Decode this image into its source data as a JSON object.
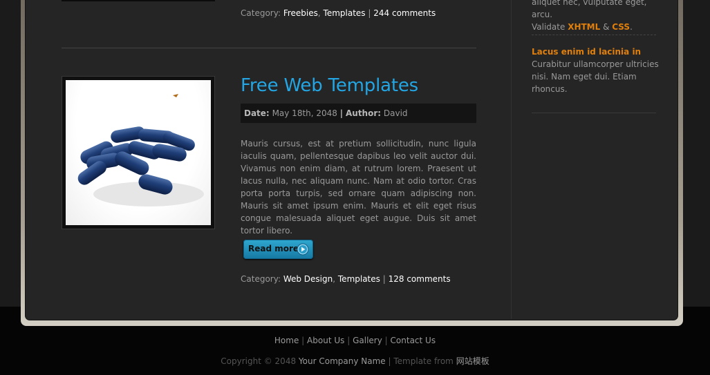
{
  "prev_post": {
    "category_label": "Category:",
    "categories": [
      "Freebies",
      "Templates"
    ],
    "comments": "244 comments"
  },
  "post": {
    "title": "Free Web Templates",
    "date_label": "Date:",
    "date": "May 18th, 2048",
    "author_label": "Author:",
    "author": "David",
    "body": "Mauris cursus, est at pretium sollicitudin, nunc ligula iaculis quam, pellentesque dapibus leo velit auctor dui. Vivamus non enim diam, at rutrum lorem. Praesent ut lacus nulla, nec aliquam nunc. Nam at odio tortor. Cras porta porta turpis, sed ornare quam adipiscing non. Mauris sit amet ipsum enim. Mauris et elit eget risus congue malesuada aliquet eget augue. Duis sit amet tortor libero.",
    "read_more": "Read more",
    "category_label": "Category:",
    "categories": [
      "Web Design",
      "Templates"
    ],
    "comments": "128 comments"
  },
  "sidebar": {
    "top_line1": "aliquet nec, vulputate eget, arcu.",
    "validate_label": "Validate",
    "xhtml": "XHTML",
    "amp": "&",
    "css": "CSS",
    "period": ".",
    "block_title": "Lacus enim id lacinia in",
    "block_text": "Curabitur ullamcorper ultricies nisi. Nam eget dui. Etiam rhoncus."
  },
  "footer": {
    "nav": [
      "Home",
      "About Us",
      "Gallery",
      "Contact Us"
    ],
    "copyright": "Copyright © 2048",
    "company": "Your Company Name",
    "template_from": "Template from",
    "template_site": "网站模板"
  },
  "colors": {
    "accent_blue": "#23a6e3",
    "accent_orange": "#e07f0c",
    "panel": "#252525",
    "link": "#ffffff"
  }
}
